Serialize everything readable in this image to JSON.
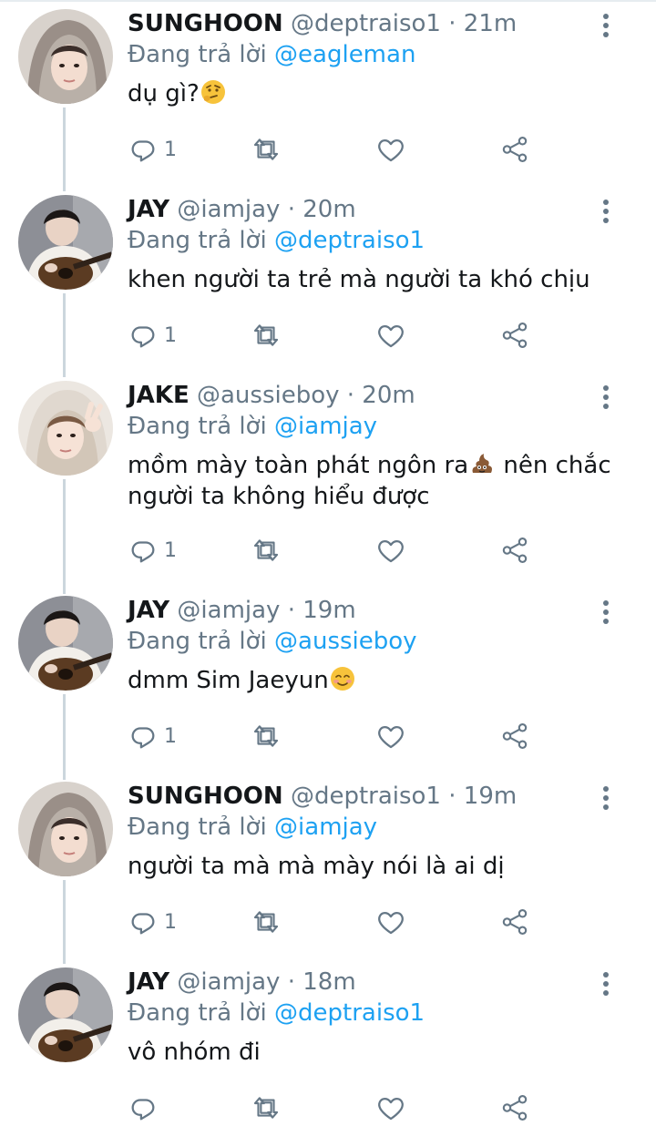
{
  "reply_prefix": "Đang trả lời",
  "tweets": [
    {
      "name": "SUNGHOON",
      "handle": "@deptraiso1",
      "time": "· 21m",
      "reply_to": "@eagleman",
      "text": "dụ gì?",
      "emoji": "thinking-face",
      "reply_count": "1",
      "avatar": "hooded-person"
    },
    {
      "name": "JAY",
      "handle": "@iamjay",
      "time": "· 20m",
      "reply_to": "@deptraiso1",
      "text": "khen người ta trẻ mà người ta khó chịu",
      "emoji": "",
      "reply_count": "1",
      "avatar": "guitar-person"
    },
    {
      "name": "JAKE",
      "handle": "@aussieboy",
      "time": "· 20m",
      "reply_to": "@iamjay",
      "text": "mồm mày toàn phát ngôn ra",
      "emoji": "poop",
      "text_after": " nên chắc người ta không hiểu được",
      "reply_count": "1",
      "avatar": "hooded-peace"
    },
    {
      "name": "JAY",
      "handle": "@iamjay",
      "time": "· 19m",
      "reply_to": "@aussieboy",
      "text": "dmm Sim Jaeyun",
      "emoji": "smiling-face",
      "reply_count": "1",
      "avatar": "guitar-person"
    },
    {
      "name": "SUNGHOON",
      "handle": "@deptraiso1",
      "time": "· 19m",
      "reply_to": "@iamjay",
      "text": "người ta mà mà mày nói là ai dị",
      "emoji": "",
      "reply_count": "1",
      "avatar": "hooded-person"
    },
    {
      "name": "JAY",
      "handle": "@iamjay",
      "time": "· 18m",
      "reply_to": "@deptraiso1",
      "text": "vô nhóm đi",
      "emoji": "",
      "reply_count": "",
      "avatar": "guitar-person"
    }
  ],
  "colors": {
    "accent": "#1da1f2",
    "muted": "#657786",
    "text": "#14171a",
    "thread": "#ccd6dd"
  },
  "icons": [
    "reply-icon",
    "retweet-icon",
    "like-icon",
    "share-icon",
    "more-icon"
  ]
}
